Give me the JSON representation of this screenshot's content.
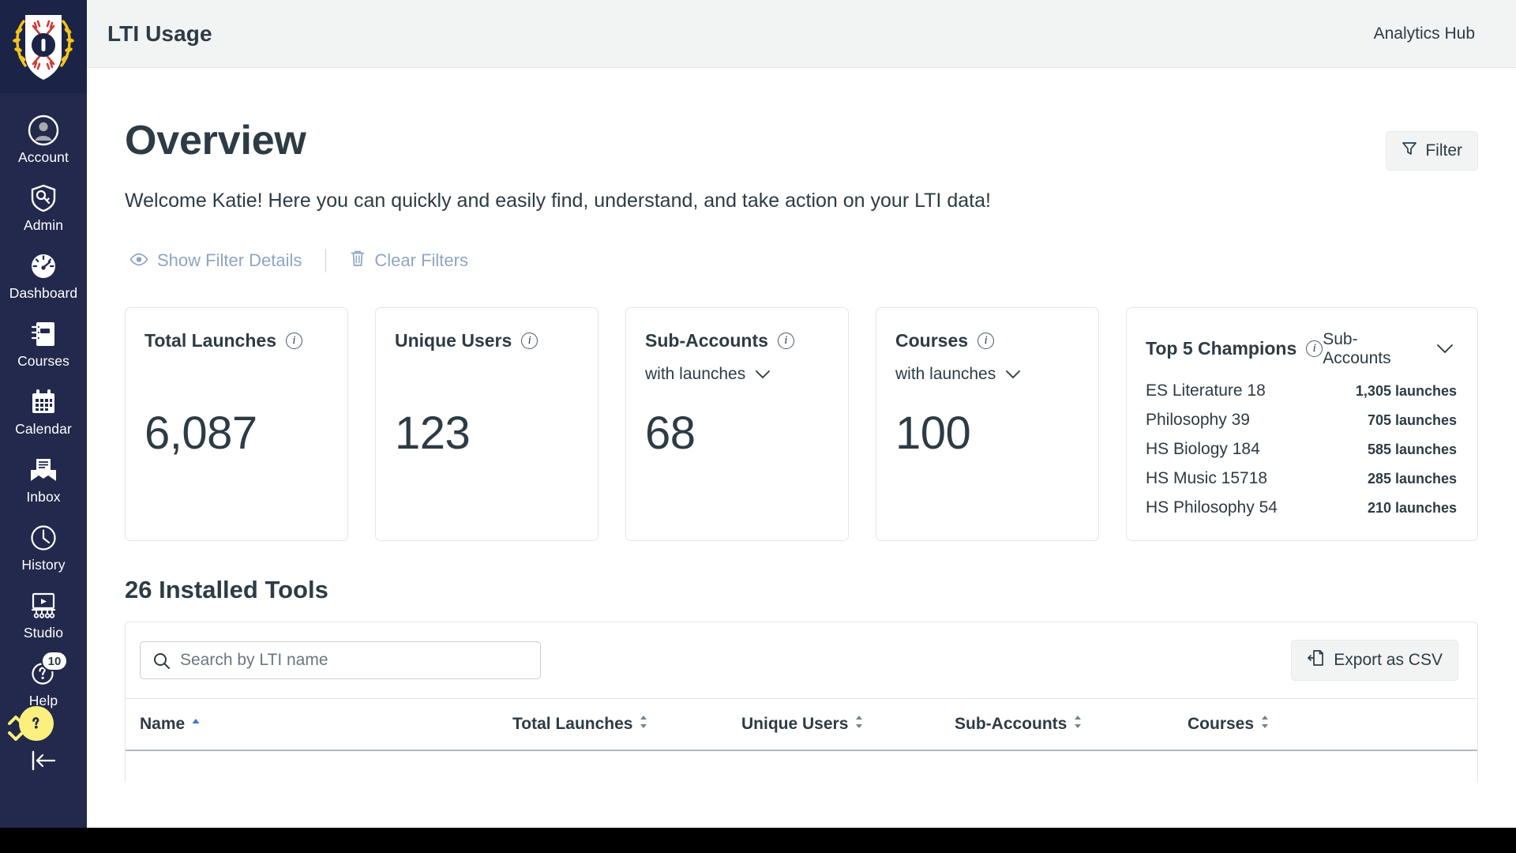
{
  "sidebar": {
    "logo_name": "school-crest-logo",
    "logo_letter": "O",
    "items": [
      {
        "label": "Account",
        "icon": "account-avatar-icon"
      },
      {
        "label": "Admin",
        "icon": "shield-key-icon"
      },
      {
        "label": "Dashboard",
        "icon": "speedometer-icon"
      },
      {
        "label": "Courses",
        "icon": "notebook-icon"
      },
      {
        "label": "Calendar",
        "icon": "calendar-icon"
      },
      {
        "label": "Inbox",
        "icon": "envelope-icon"
      },
      {
        "label": "History",
        "icon": "clock-icon"
      },
      {
        "label": "Studio",
        "icon": "studio-screen-icon"
      },
      {
        "label": "Help",
        "icon": "question-bubble-icon"
      }
    ],
    "help_badge": "10",
    "help_fab_glyph": "?",
    "collapse_label": "collapse-menu"
  },
  "topbar": {
    "title": "LTI Usage",
    "right_label": "Analytics Hub"
  },
  "page": {
    "title": "Overview",
    "welcome": "Welcome Katie! Here you can quickly and easily find, understand, and take action on your LTI data!",
    "filter_button": "Filter",
    "show_filter_details": "Show Filter Details",
    "clear_filters": "Clear Filters"
  },
  "stat_cards": [
    {
      "title": "Total Launches",
      "sub": null,
      "value": "6,087"
    },
    {
      "title": "Unique Users",
      "sub": null,
      "value": "123"
    },
    {
      "title": "Sub-Accounts",
      "sub": "with launches",
      "value": "68"
    },
    {
      "title": "Courses",
      "sub": "with launches",
      "value": "100"
    }
  ],
  "champions": {
    "title": "Top 5 Champions",
    "selector": "Sub-Accounts",
    "rows": [
      {
        "name": "ES Literature 18",
        "value": "1,305 launches"
      },
      {
        "name": "Philosophy 39",
        "value": "705 launches"
      },
      {
        "name": "HS Biology 184",
        "value": "585 launches"
      },
      {
        "name": "HS Music 15718",
        "value": "285 launches"
      },
      {
        "name": "HS Philosophy 54",
        "value": "210 launches"
      }
    ]
  },
  "tools": {
    "heading": "26 Installed Tools",
    "search_placeholder": "Search by LTI name",
    "search_value": "",
    "export_label": "Export as CSV",
    "columns": [
      {
        "label": "Name",
        "sort": "asc"
      },
      {
        "label": "Total Launches",
        "sort": "none"
      },
      {
        "label": "Unique Users",
        "sort": "none"
      },
      {
        "label": "Sub-Accounts",
        "sort": "none"
      },
      {
        "label": "Courses",
        "sort": "none"
      }
    ],
    "rows": []
  },
  "colors": {
    "sidebar_bg": "#22294c",
    "text": "#2d3b45",
    "link": "#8fa5c4",
    "accent_yellow": "#fbf07e",
    "panel_bg": "#f2f4f4",
    "sort_active": "#3b7ac4"
  }
}
